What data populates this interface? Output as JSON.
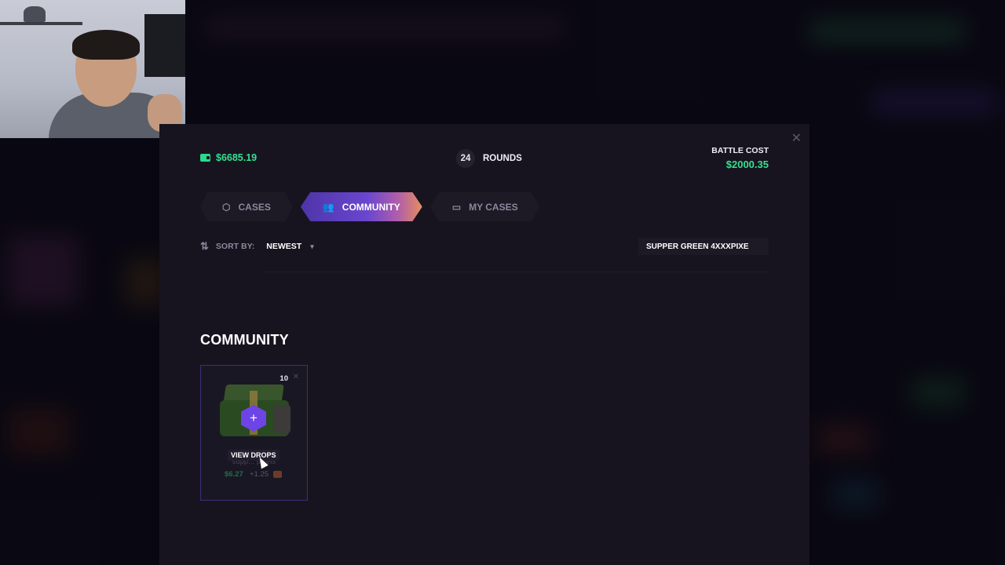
{
  "modal": {
    "balance": "$6685.19",
    "rounds_count": "24",
    "rounds_label": "ROUNDS",
    "battle_cost_label": "BATTLE COST",
    "battle_cost_value": "$2000.35",
    "close_icon": "close-icon"
  },
  "tabs": [
    {
      "label": "CASES",
      "icon": "box-icon",
      "active": false
    },
    {
      "label": "COMMUNITY",
      "icon": "users-icon",
      "active": true
    },
    {
      "label": "MY CASES",
      "icon": "folder-icon",
      "active": false
    }
  ],
  "sort": {
    "label": "SORT BY:",
    "value": "NEWEST"
  },
  "search": {
    "value": "SUPPER GREEN 4XXXPIXE"
  },
  "section": {
    "title": "COMMUNITY"
  },
  "cards": [
    {
      "quantity": "10",
      "hover_label": "VIEW DROPS",
      "name": "supp... pixels",
      "price": "$6.27",
      "extra": "+1.25"
    }
  ],
  "colors": {
    "accent_purple": "#6d44e6",
    "money_green": "#34e08f",
    "modal_bg": "#17141f"
  }
}
